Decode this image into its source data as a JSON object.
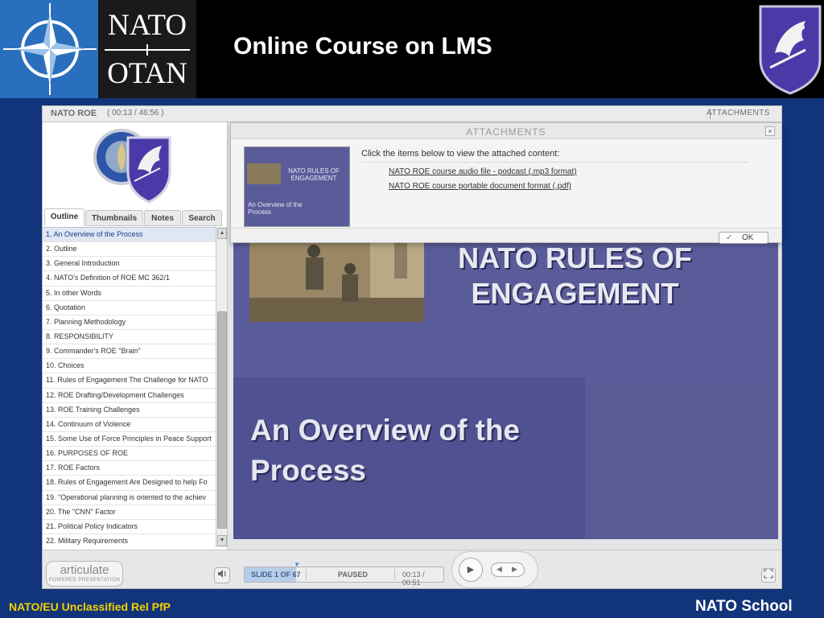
{
  "header": {
    "logo_line1": "NATO",
    "logo_line2": "OTAN",
    "title": "Online Course on LMS"
  },
  "player": {
    "course_title": "NATO ROE",
    "course_time": "( 00:13 / 46:56 )",
    "attachments_button": "ATTACHMENTS",
    "tabs": [
      "Outline",
      "Thumbnails",
      "Notes",
      "Search"
    ],
    "active_tab": "Outline",
    "outline": [
      "1. An Overview of the Process",
      "2. Outline",
      "3. General Introduction",
      "4. NATO's Definition of ROE MC 362/1",
      "5. In other Words",
      "6. Quotation",
      "7. Planning Methodology",
      "8. RESPONSIBILITY",
      "9. Commander's ROE \"Brain\"",
      "10. Choices",
      "11. Rules of Engagement The Challenge for NATO",
      "12. ROE Drafting/Development Challenges",
      "13. ROE Training Challenges",
      "14. Continuum of Violence",
      "15. Some Use of Force Principles in Peace Support",
      "16. PURPOSES OF ROE",
      "17. ROE Factors",
      "18. Rules of Engagement Are Designed to help Fo",
      "19. \"Operational planning is oriented to the achiev",
      "20. The \"CNN\" Factor",
      "21. Political Policy Indicators",
      "22. Military Requirements"
    ],
    "active_outline_index": 0
  },
  "slide": {
    "title_line1": "NATO RULES OF",
    "title_line2": "ENGAGEMENT",
    "subtitle_line1": "An Overview of the",
    "subtitle_line2": "Process"
  },
  "attachments_popup": {
    "title": "ATTACHMENTS",
    "close_icon": "×",
    "thumb_title_line1": "NATO RULES OF",
    "thumb_title_line2": "ENGAGEMENT",
    "thumb_subtitle_line1": "An Overview of the",
    "thumb_subtitle_line2": "Process",
    "intro": "Click the items below to view the attached content:",
    "links": [
      "NATO ROE course audio file - podcast (.mp3 format)",
      "NATO ROE course portable document format (.pdf)"
    ],
    "ok_label": "OK",
    "ok_icon": "✓"
  },
  "controls": {
    "brand": "articulate",
    "brand_tagline": "POWERED PRESENTATION",
    "slide_count": "SLIDE 1 OF 67",
    "status": "PAUSED",
    "time": "00:13 / 00:51",
    "progress_fraction": 0.26,
    "play_icon": "▶",
    "prev_icon": "◀",
    "next_icon": "▶",
    "volume_icon": "speaker-icon",
    "fullscreen_icon": "fullscreen-icon"
  },
  "footer": {
    "classification": "NATO/EU Unclassified Rel PfP",
    "school": "NATO School"
  },
  "colors": {
    "background": "#12347a",
    "slide": "#5a5c9a",
    "classification": "#f0d200"
  }
}
